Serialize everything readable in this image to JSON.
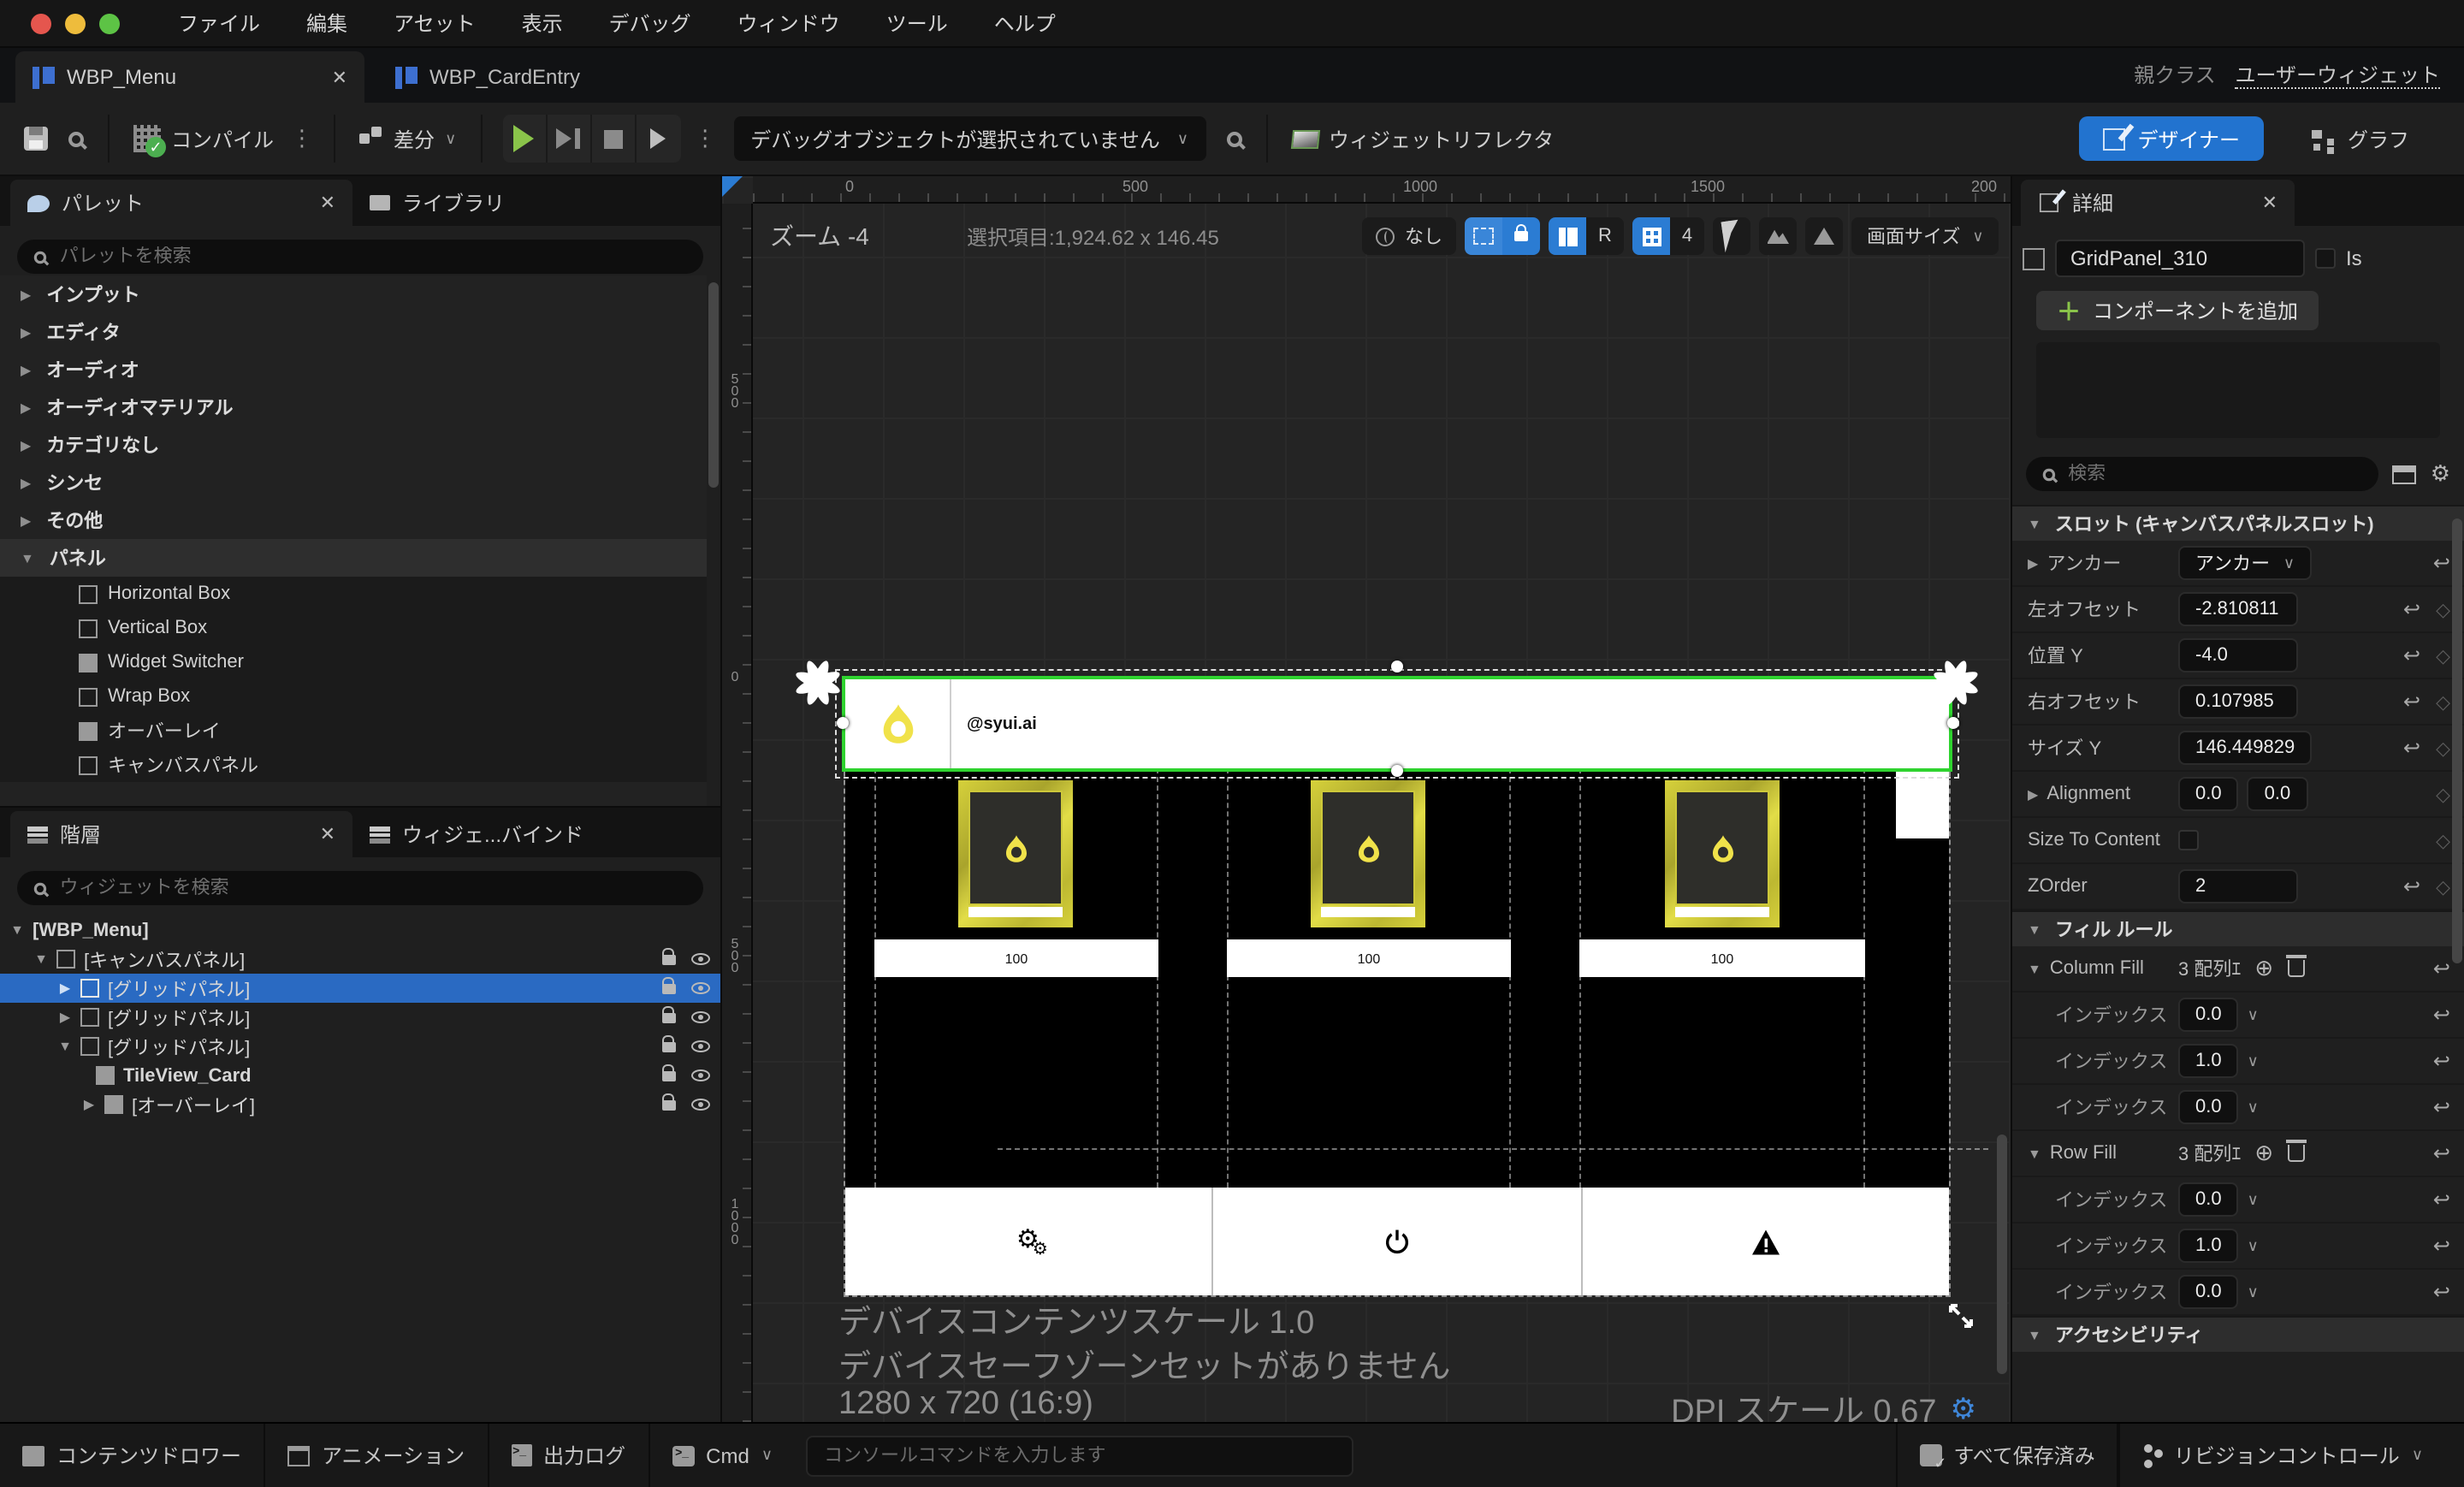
{
  "colors": {
    "accent_blue": "#2b7cd3",
    "play_green": "#8ac44a",
    "card_yellow": "#e5e04a",
    "selection_green": "#2fd32f"
  },
  "menubar": {
    "items": [
      "ファイル",
      "編集",
      "アセット",
      "表示",
      "デバッグ",
      "ウィンドウ",
      "ツール",
      "ヘルプ"
    ]
  },
  "tabstrip": {
    "tabs": [
      {
        "label": "WBP_Menu"
      },
      {
        "label": "WBP_CardEntry"
      }
    ],
    "close_glyph": "✕",
    "parent_class_label": "親クラス",
    "parent_class_value": "ユーザーウィジェット"
  },
  "toolbar": {
    "compile": "コンパイル",
    "diff": "差分",
    "debug_dropdown": "デバッグオブジェクトが選択されていません",
    "widget_reflector": "ウィジェットリフレクタ",
    "designer": "デザイナー",
    "graph": "グラフ"
  },
  "palette": {
    "tab": "パレット",
    "library_tab": "ライブラリ",
    "search_placeholder": "パレットを検索",
    "categories": [
      "インプット",
      "エディタ",
      "オーディオ",
      "オーディオマテリアル",
      "カテゴリなし",
      "シンセ",
      "その他"
    ],
    "panel_category": "パネル",
    "panel_items": [
      "Horizontal Box",
      "Vertical Box",
      "Widget Switcher",
      "Wrap Box",
      "オーバーレイ",
      "キャンバスパネル"
    ]
  },
  "hierarchy": {
    "tab": "階層",
    "bind_tab": "ウィジェ...バインド",
    "search_placeholder": "ウィジェットを検索",
    "rows": [
      {
        "label": "[WBP_Menu]"
      },
      {
        "label": "[キャンバスパネル]"
      },
      {
        "label": "[グリッドパネル]"
      },
      {
        "label": "[グリッドパネル]"
      },
      {
        "label": "[グリッドパネル]"
      },
      {
        "label": "TileView_Card"
      },
      {
        "label": "[オーバーレイ]"
      }
    ]
  },
  "viewport": {
    "zoom": "ズーム -4",
    "selection": "選択項目:1,924.62 x 146.45",
    "none_button": "なし",
    "r_button": "R",
    "grid_size": "4",
    "screen_size": "画面サイズ",
    "ruler_h": [
      "0",
      "500",
      "1000",
      "1500",
      "200"
    ],
    "ruler_v": [
      "500",
      "0",
      "500",
      "1000"
    ],
    "handle": "@syui.ai",
    "card_value": "100",
    "overlay": [
      "デバイスコンテンツスケール 1.0",
      "デバイスセーフゾーンセットがありません",
      "1280 x 720 (16:9)"
    ],
    "dpi": "DPI スケール 0.67"
  },
  "details": {
    "tab": "詳細",
    "widget_name": "GridPanel_310",
    "is_label": "Is",
    "add_component": "コンポーネントを追加",
    "search_placeholder": "検索",
    "slot_section": "スロット (キャンバスパネルスロット)",
    "anchor_label": "アンカー",
    "anchor_value": "アンカー",
    "offset_left_label": "左オフセット",
    "offset_left": "-2.810811",
    "pos_y_label": "位置 Y",
    "pos_y": "-4.0",
    "offset_right_label": "右オフセット",
    "offset_right": "0.107985",
    "size_y_label": "サイズ Y",
    "size_y": "146.449829",
    "alignment_label": "Alignment",
    "alignment_x": "0.0",
    "alignment_y": "0.0",
    "size_to_content_label": "Size To Content",
    "zorder_label": "ZOrder",
    "zorder": "2",
    "fill_section": "フィル ルール",
    "column_fill_label": "Column Fill",
    "column_fill_count": "3 配列ｴ",
    "row_fill_label": "Row Fill",
    "row_fill_count": "3 配列ｴ",
    "index_label": "インデックス",
    "column_indexes": [
      "0.0",
      "1.0",
      "0.0"
    ],
    "row_indexes": [
      "0.0",
      "1.0",
      "0.0"
    ],
    "accessibility_section": "アクセシビリティ"
  },
  "statusbar": {
    "content_drawer": "コンテンツドロワー",
    "animation": "アニメーション",
    "output_log": "出力ログ",
    "cmd": "Cmd",
    "console_placeholder": "コンソールコマンドを入力します",
    "saved": "すべて保存済み",
    "revision_control": "リビジョンコントロール"
  }
}
